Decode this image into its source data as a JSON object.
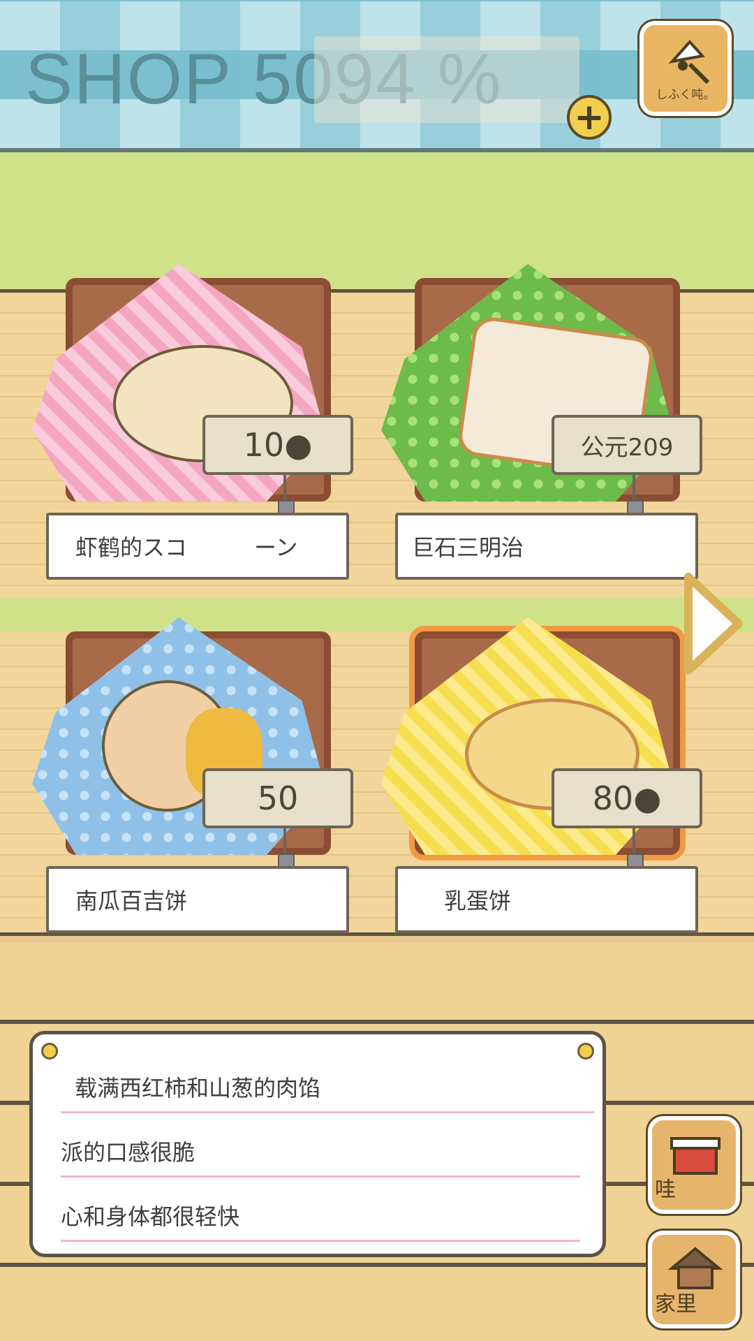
{
  "hud": {
    "title": "SHOP 5094 %",
    "plus_label": "+",
    "bell_label": "しふく吨。"
  },
  "items": [
    {
      "name": "虾鹤的スコ　　　ーン",
      "price": "10●"
    },
    {
      "name": "巨石三明治",
      "price": "公元209"
    },
    {
      "name": "南瓜百吉饼",
      "price": "50"
    },
    {
      "name": "乳蛋饼",
      "price": "80●"
    }
  ],
  "description": {
    "lines": [
      "载满西红柿和山葱的肉馅",
      "派的口感很脆",
      "心和身体都很轻快"
    ]
  },
  "side_buttons": {
    "shop_label": "哇",
    "home_label": "家里"
  },
  "icons": {
    "bell": "bell-icon",
    "next": "chevron-right-icon",
    "shop": "shop-icon",
    "home": "home-icon"
  },
  "colors": {
    "accent": "#f19a42",
    "awning": "#7cc0cf",
    "wall": "#cfe28a"
  }
}
